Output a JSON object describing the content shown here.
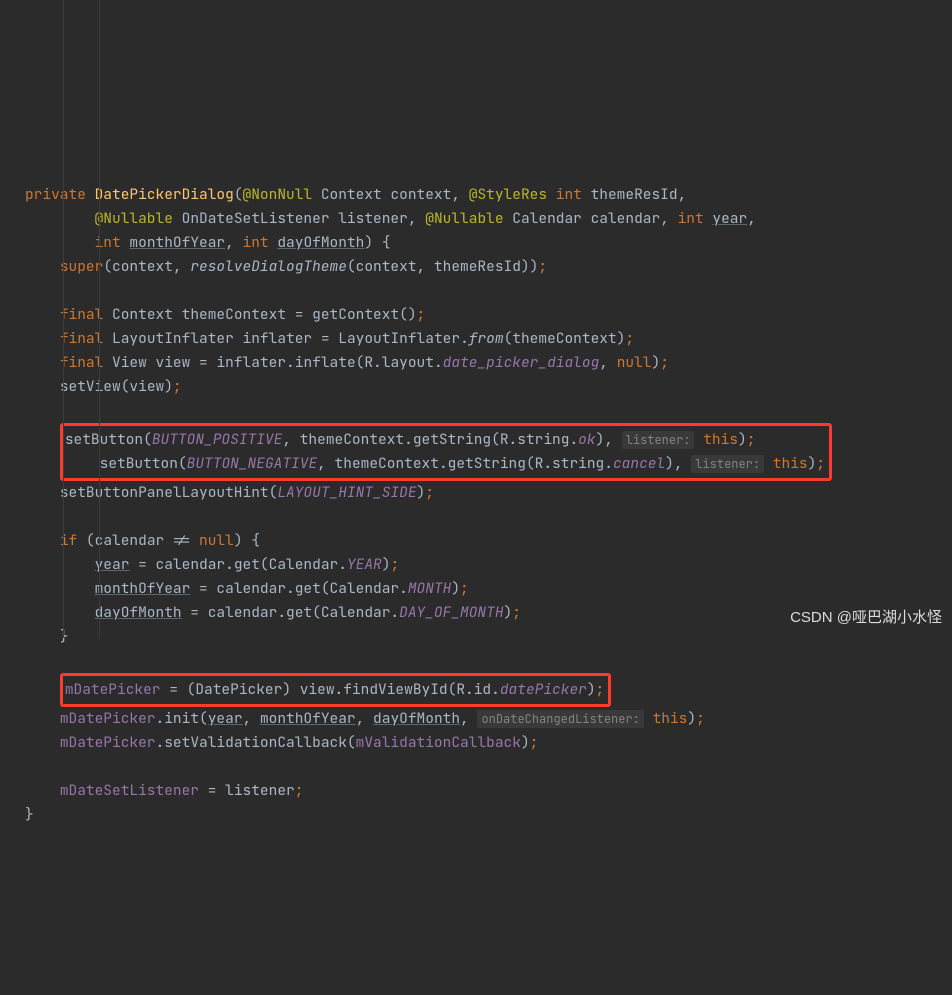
{
  "code": {
    "l1_private": "private",
    "l1_method": "DatePickerDialog",
    "l1_anno_nonnull": "@NonNull",
    "l1_context_type": "Context",
    "l1_context_param": "context",
    "l1_anno_styleres": "@StyleRes",
    "l1_int": "int",
    "l1_themeresid": "themeResId",
    "l2_anno_nullable": "@Nullable",
    "l2_ondatesetlistener": "OnDateSetListener",
    "l2_listener": "listener",
    "l2_calendar_type": "Calendar",
    "l2_calendar_param": "calendar",
    "l2_year": "year",
    "l3_monthofyear": "monthOfYear",
    "l3_dayofmonth": "dayOfMonth",
    "l4_super": "super",
    "l4_resolve": "resolveDialogTheme",
    "l6_final": "final",
    "l6_themecontext": "themeContext",
    "l6_getcontext": "getContext",
    "l7_layoutinflater": "LayoutInflater",
    "l7_inflater": "inflater",
    "l7_from": "from",
    "l8_view_type": "View",
    "l8_view": "view",
    "l8_inflate": "inflate",
    "l8_r_layout": "R.layout.",
    "l8_dpd": "date_picker_dialog",
    "l8_null": "null",
    "l9_setview": "setView",
    "l11_setbutton": "setButton",
    "l11_btnpos": "BUTTON_POSITIVE",
    "l11_getstring": "getString",
    "l11_rstring": "R.string.",
    "l11_ok": "ok",
    "l11_hint": "listener:",
    "l11_this": "this",
    "l12_btnneg": "BUTTON_NEGATIVE",
    "l12_cancel": "cancel",
    "l13_setbuttonpanel": "setButtonPanelLayoutHint",
    "l13_layouthint": "LAYOUT_HINT_SIDE",
    "l15_if": "if",
    "l15_ne_null": " != ",
    "l16_calendar_get": "calendar.get(Calendar.",
    "l16_year_c": "YEAR",
    "l17_month_c": "MONTH",
    "l18_dom_c": "DAY_OF_MONTH",
    "l21_mdatepicker": "mDatePicker",
    "l21_cast": "(DatePicker) ",
    "l21_findview": "view.findViewById(R.id.",
    "l21_datepicker": "datePicker",
    "l22_init": ".init(",
    "l22_hint": "onDateChangedListener:",
    "l23_setval": ".setValidationCallback(",
    "l23_mval": "mValidationCallback",
    "l25_mdateset": "mDateSetListener",
    "l25_eq_listener": " = listener"
  },
  "watermark": "CSDN @哑巴湖小水怪"
}
